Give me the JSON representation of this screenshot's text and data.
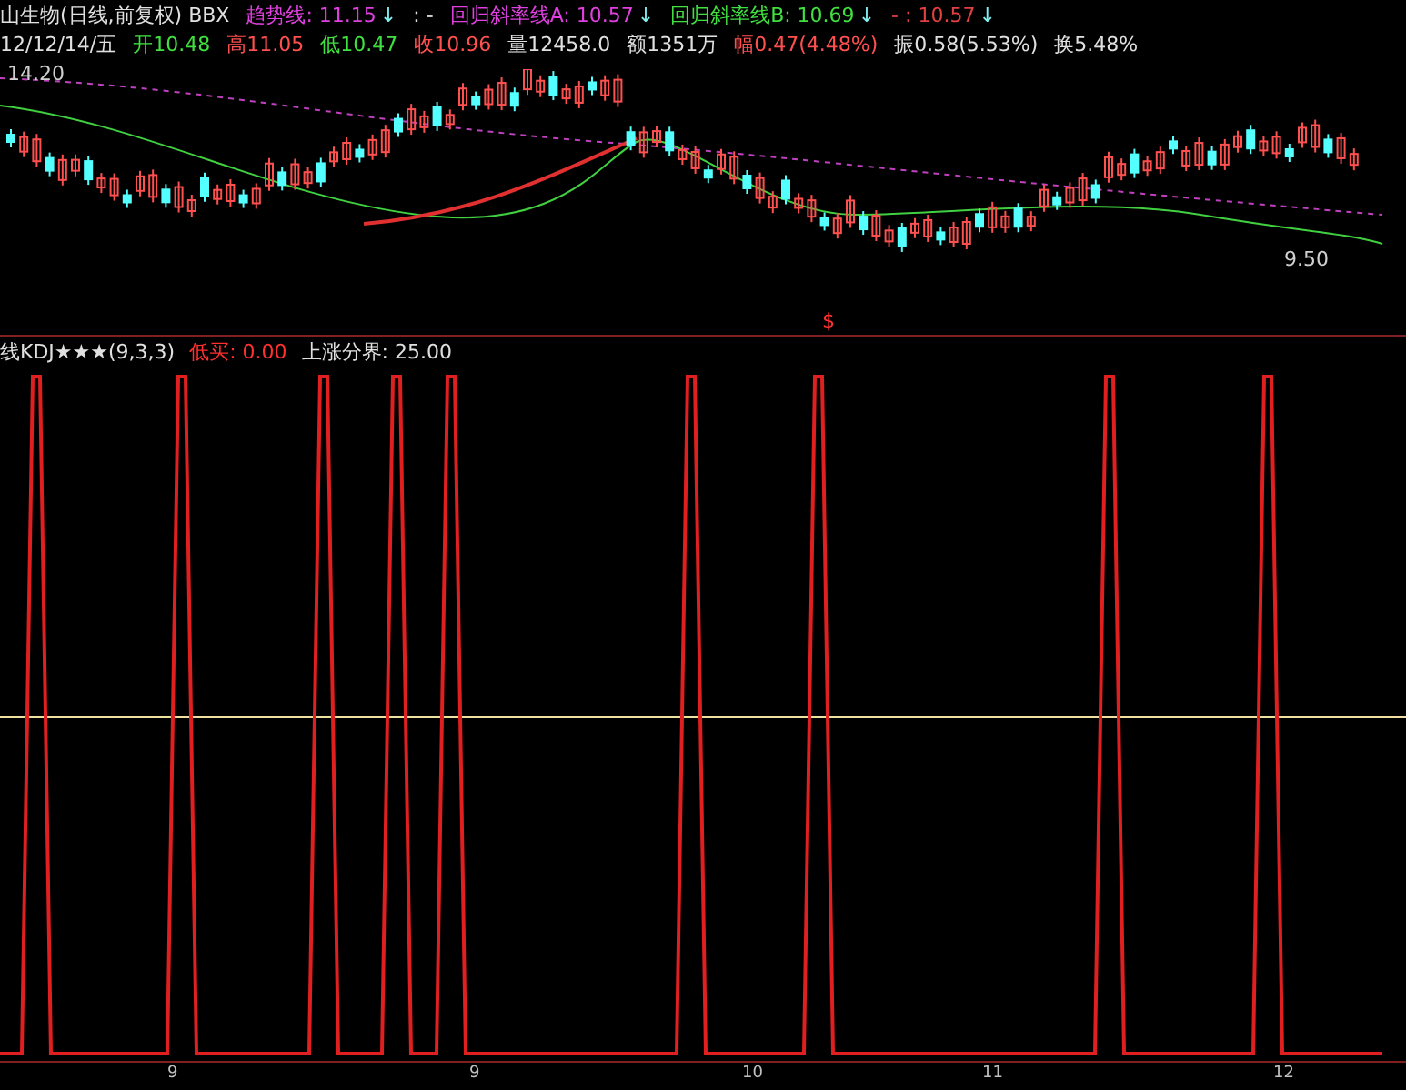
{
  "quote_line": [
    {
      "text": "山生物(日线,前复权) BBX",
      "color": "#e0e0e0"
    },
    {
      "text": "趋势线: 11.15",
      "color": "#e040e0",
      "arrow": "↓"
    },
    {
      "text": ": -",
      "color": "#e0e0e0"
    },
    {
      "text": "回归斜率线A: 10.57",
      "color": "#e040e0",
      "arrow": "↓"
    },
    {
      "text": "回归斜率线B: 10.69",
      "color": "#40e040",
      "arrow": "↓"
    },
    {
      "text": "- : 10.57",
      "color": "#e04040",
      "arrow": "↓"
    }
  ],
  "bar_info": [
    {
      "text": "12/12/14/五",
      "color": "#e0e0e0"
    },
    {
      "text": "开10.48",
      "color": "#40e040"
    },
    {
      "text": "高11.05",
      "color": "#ff5050"
    },
    {
      "text": "低10.47",
      "color": "#40e040"
    },
    {
      "text": "收10.96",
      "color": "#ff5050"
    },
    {
      "text": "量12458.0",
      "color": "#e0e0e0"
    },
    {
      "text": "额1351万",
      "color": "#e0e0e0"
    },
    {
      "text": "幅0.47(4.48%)",
      "color": "#ff5050"
    },
    {
      "text": "振0.58(5.53%)",
      "color": "#e0e0e0"
    },
    {
      "text": "换5.48%",
      "color": "#e0e0e0"
    }
  ],
  "price_chart": {
    "high_label": "14.20",
    "low_label": "9.50",
    "signal_mark": "$"
  },
  "indicator": {
    "title": "线KDJ★★★(9,3,3)",
    "buy_low": "低买: 0.00",
    "rise_line": "上涨分界: 25.00"
  },
  "time_axis": [
    "9",
    "9",
    "10",
    "11",
    "12"
  ]
}
